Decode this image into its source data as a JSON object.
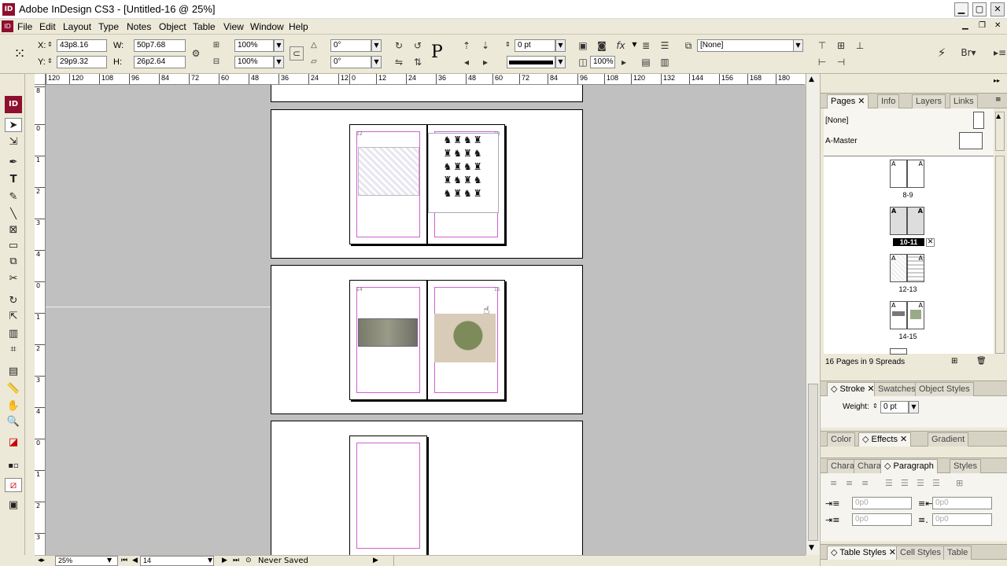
{
  "window": {
    "title": "Adobe InDesign CS3 - [Untitled-16 @ 25%]",
    "app_badge": "ID"
  },
  "menu": [
    "File",
    "Edit",
    "Layout",
    "Type",
    "Notes",
    "Object",
    "Table",
    "View",
    "Window",
    "Help"
  ],
  "control": {
    "x_label": "X:",
    "x_value": "43p8.16",
    "y_label": "Y:",
    "y_value": "29p9.32",
    "w_label": "W:",
    "w_value": "50p7.68",
    "h_label": "H:",
    "h_value": "26p2.64",
    "scale_x": "100%",
    "scale_y": "100%",
    "rotate": "0°",
    "shear": "0°",
    "stroke_weight": "0 pt",
    "style_name": "[None]",
    "zoom_field": "100%"
  },
  "ruler_top": [
    "120",
    "108",
    "96",
    "84",
    "72",
    "60",
    "48",
    "36",
    "24",
    "12",
    "0",
    "12",
    "24",
    "36",
    "48",
    "60",
    "72",
    "84",
    "96",
    "108",
    "120",
    "132",
    "144",
    "156",
    "168",
    "180"
  ],
  "ruler_left": [
    "8",
    "0",
    "1",
    "2",
    "3",
    "4",
    "5",
    "6",
    "0",
    "1",
    "2",
    "3",
    "4",
    "5",
    "6",
    "0",
    "1",
    "2",
    "3",
    "4",
    "5"
  ],
  "spreads": {
    "page_labels": [
      "12",
      "13",
      "14",
      "15"
    ]
  },
  "pages_panel": {
    "tabs": [
      "Pages",
      "Info",
      "Layers",
      "Links"
    ],
    "masters": [
      "[None]",
      "A-Master"
    ],
    "spreads": [
      "8-9",
      "10-11",
      "12-13",
      "14-15"
    ],
    "master_letter": "A",
    "status": "16 Pages in 9 Spreads"
  },
  "stroke_panel": {
    "tabs": [
      "Stroke",
      "Swatches",
      "Object Styles"
    ],
    "weight_label": "Weight:",
    "weight_value": "0 pt"
  },
  "color_panel": {
    "tabs": [
      "Color",
      "Effects",
      "Gradient"
    ]
  },
  "para_panel": {
    "tabs": [
      "Chara",
      "Chara",
      "Paragraph",
      "Styles"
    ],
    "indent_values": [
      "0p0",
      "0p0",
      "0p0",
      "0p0"
    ]
  },
  "table_panel": {
    "tabs": [
      "Table Styles",
      "Cell Styles",
      "Table"
    ]
  },
  "status": {
    "zoom": "25%",
    "page": "14",
    "save_state": "Never Saved"
  }
}
